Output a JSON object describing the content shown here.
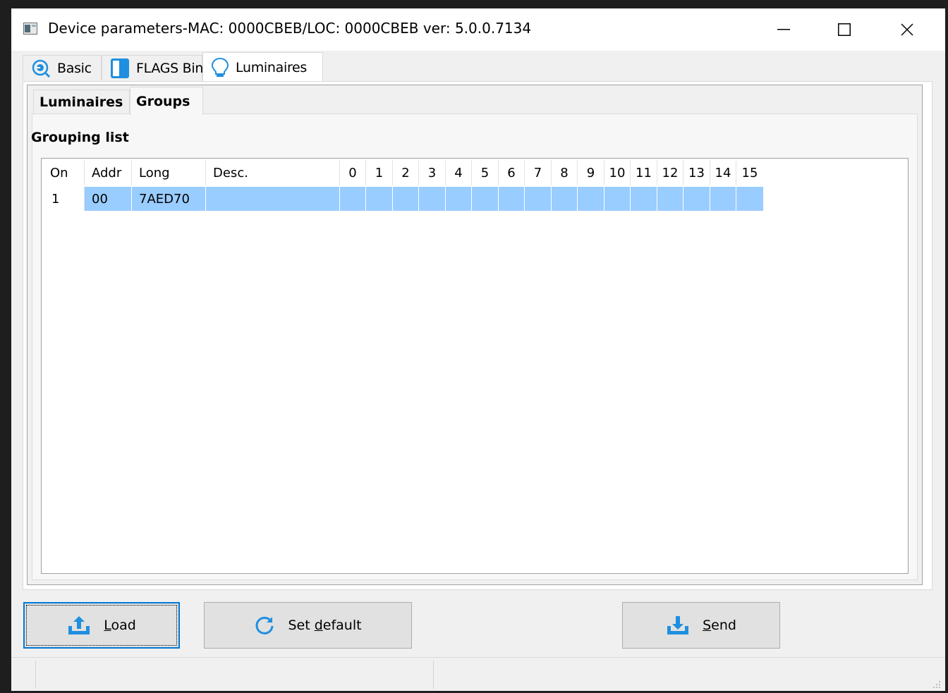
{
  "window": {
    "title": "Device parameters-MAC: 0000CBEB/LOC: 0000CBEB ver: 5.0.0.7134"
  },
  "outer_tabs": [
    {
      "label": "Basic",
      "icon": "network-icon"
    },
    {
      "label": "FLAGS Bin",
      "icon": "flags-icon"
    },
    {
      "label": "Luminaires",
      "icon": "bulb-icon",
      "active": true
    }
  ],
  "inner_tabs": [
    {
      "label": "Luminaires"
    },
    {
      "label": "Groups",
      "active": true
    }
  ],
  "section_title": "Grouping list",
  "table": {
    "columns": [
      "On",
      "Addr",
      "Long",
      "Desc.",
      "0",
      "1",
      "2",
      "3",
      "4",
      "5",
      "6",
      "7",
      "8",
      "9",
      "10",
      "11",
      "12",
      "13",
      "14",
      "15"
    ],
    "rows": [
      [
        "1",
        "00",
        "7AED70",
        "",
        "",
        "",
        "",
        "",
        "",
        "",
        "",
        "",
        "",
        "",
        "",
        "",
        "",
        "",
        "",
        ""
      ]
    ]
  },
  "buttons": {
    "load": {
      "mnemonic": "L",
      "rest": "oad"
    },
    "set_default": {
      "pre": "Set ",
      "mnemonic": "d",
      "rest": "efault"
    },
    "send": {
      "mnemonic": "S",
      "rest": "end"
    }
  },
  "colors": {
    "selection": "#99ccff",
    "focus": "#0078d7",
    "icon_blue": "#1f8fe0"
  }
}
